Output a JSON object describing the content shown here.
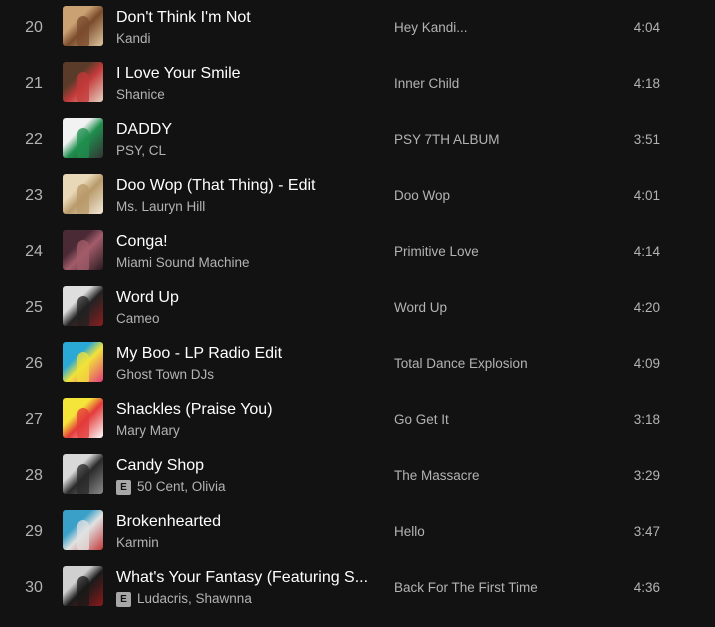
{
  "tracks": [
    {
      "num": "20",
      "title": "Don't Think I'm Not",
      "artists": "Kandi",
      "explicit": false,
      "album": "Hey Kandi...",
      "duration": "4:04",
      "cover_colors": [
        "#caa173",
        "#7a4b2c",
        "#e0c8a0"
      ],
      "cover_icon": "album-cover-kandi"
    },
    {
      "num": "21",
      "title": "I Love Your Smile",
      "artists": "Shanice",
      "explicit": false,
      "album": "Inner Child",
      "duration": "4:18",
      "cover_colors": [
        "#5a3b2a",
        "#c33a3a",
        "#e7d3c2"
      ],
      "cover_icon": "album-cover-shanice"
    },
    {
      "num": "22",
      "title": "DADDY",
      "artists": "PSY, CL",
      "explicit": false,
      "album": "PSY 7TH ALBUM",
      "duration": "3:51",
      "cover_colors": [
        "#f2f2f2",
        "#1f8f4e",
        "#333333"
      ],
      "cover_icon": "album-cover-psy"
    },
    {
      "num": "23",
      "title": "Doo Wop (That Thing) - Edit",
      "artists": "Ms. Lauryn Hill",
      "explicit": false,
      "album": "Doo Wop",
      "duration": "4:01",
      "cover_colors": [
        "#e9d8b8",
        "#b89a6a",
        "#f3ead8"
      ],
      "cover_icon": "album-cover-lauryn-hill"
    },
    {
      "num": "24",
      "title": "Conga!",
      "artists": "Miami Sound Machine",
      "explicit": false,
      "album": "Primitive Love",
      "duration": "4:14",
      "cover_colors": [
        "#4a2a35",
        "#a35c6a",
        "#2a1a20"
      ],
      "cover_icon": "album-cover-miami-sound-machine"
    },
    {
      "num": "25",
      "title": "Word Up",
      "artists": "Cameo",
      "explicit": false,
      "album": "Word Up",
      "duration": "4:20",
      "cover_colors": [
        "#dedede",
        "#222222",
        "#8a1f1f"
      ],
      "cover_icon": "album-cover-cameo"
    },
    {
      "num": "26",
      "title": "My Boo - LP Radio Edit",
      "artists": "Ghost Town DJs",
      "explicit": false,
      "album": "Total Dance Explosion",
      "duration": "4:09",
      "cover_colors": [
        "#2aa9d6",
        "#f2e23a",
        "#e33b7a"
      ],
      "cover_icon": "album-cover-total-dance-explosion"
    },
    {
      "num": "27",
      "title": "Shackles (Praise You)",
      "artists": "Mary Mary",
      "explicit": false,
      "album": "Go Get It",
      "duration": "3:18",
      "cover_colors": [
        "#f5e43a",
        "#e33a3a",
        "#ffffff"
      ],
      "cover_icon": "album-cover-mary-mary"
    },
    {
      "num": "28",
      "title": "Candy Shop",
      "artists": "50 Cent, Olivia",
      "explicit": true,
      "explicit_label": "E",
      "album": "The Massacre",
      "duration": "3:29",
      "cover_colors": [
        "#d8d8d8",
        "#2a2a2a",
        "#8a8a8a"
      ],
      "cover_icon": "album-cover-50-cent"
    },
    {
      "num": "29",
      "title": "Brokenhearted",
      "artists": "Karmin",
      "explicit": false,
      "album": "Hello",
      "duration": "3:47",
      "cover_colors": [
        "#3aa0c8",
        "#e2e2e2",
        "#c23a3a"
      ],
      "cover_icon": "album-cover-karmin"
    },
    {
      "num": "30",
      "title": "What's Your Fantasy (Featuring S...",
      "artists": "Ludacris, Shawnna",
      "explicit": true,
      "explicit_label": "E",
      "album": "Back For The First Time",
      "duration": "4:36",
      "cover_colors": [
        "#d0d0d0",
        "#1a1a1a",
        "#8a1a1a"
      ],
      "cover_icon": "album-cover-ludacris"
    }
  ]
}
